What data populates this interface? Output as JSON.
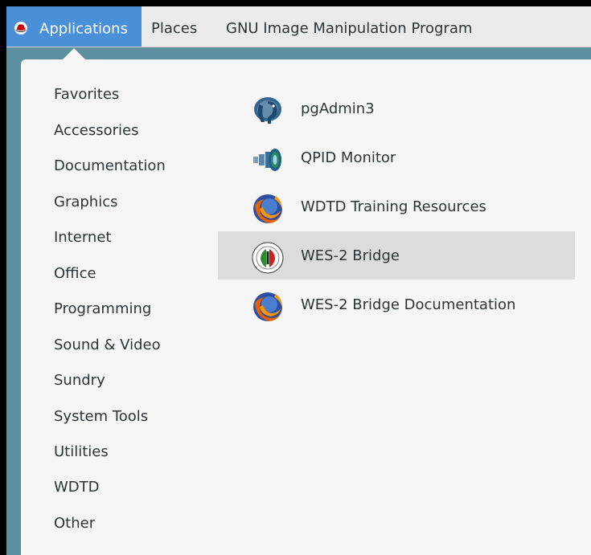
{
  "topbar": {
    "applications_label": "Applications",
    "places_label": "Places",
    "active_app_label": "GNU Image Manipulation Program"
  },
  "categories": [
    "Favorites",
    "Accessories",
    "Documentation",
    "Graphics",
    "Internet",
    "Office",
    "Programming",
    "Sound & Video",
    "Sundry",
    "System Tools",
    "Utilities",
    "WDTD",
    "Other"
  ],
  "apps": [
    {
      "label": "pgAdmin3",
      "icon": "elephant-icon"
    },
    {
      "label": "QPID Monitor",
      "icon": "qpid-monitor-icon"
    },
    {
      "label": "WDTD Training Resources",
      "icon": "firefox-icon"
    },
    {
      "label": "WES-2 Bridge",
      "icon": "wes2-bridge-icon",
      "highlighted": true
    },
    {
      "label": "WES-2 Bridge Documentation",
      "icon": "firefox-icon"
    }
  ],
  "colors": {
    "accent": "#4a90d9",
    "desktop": "#5d8fa0",
    "menu_bg": "#f6f6f6",
    "hover_row": "#dcdcdc"
  }
}
